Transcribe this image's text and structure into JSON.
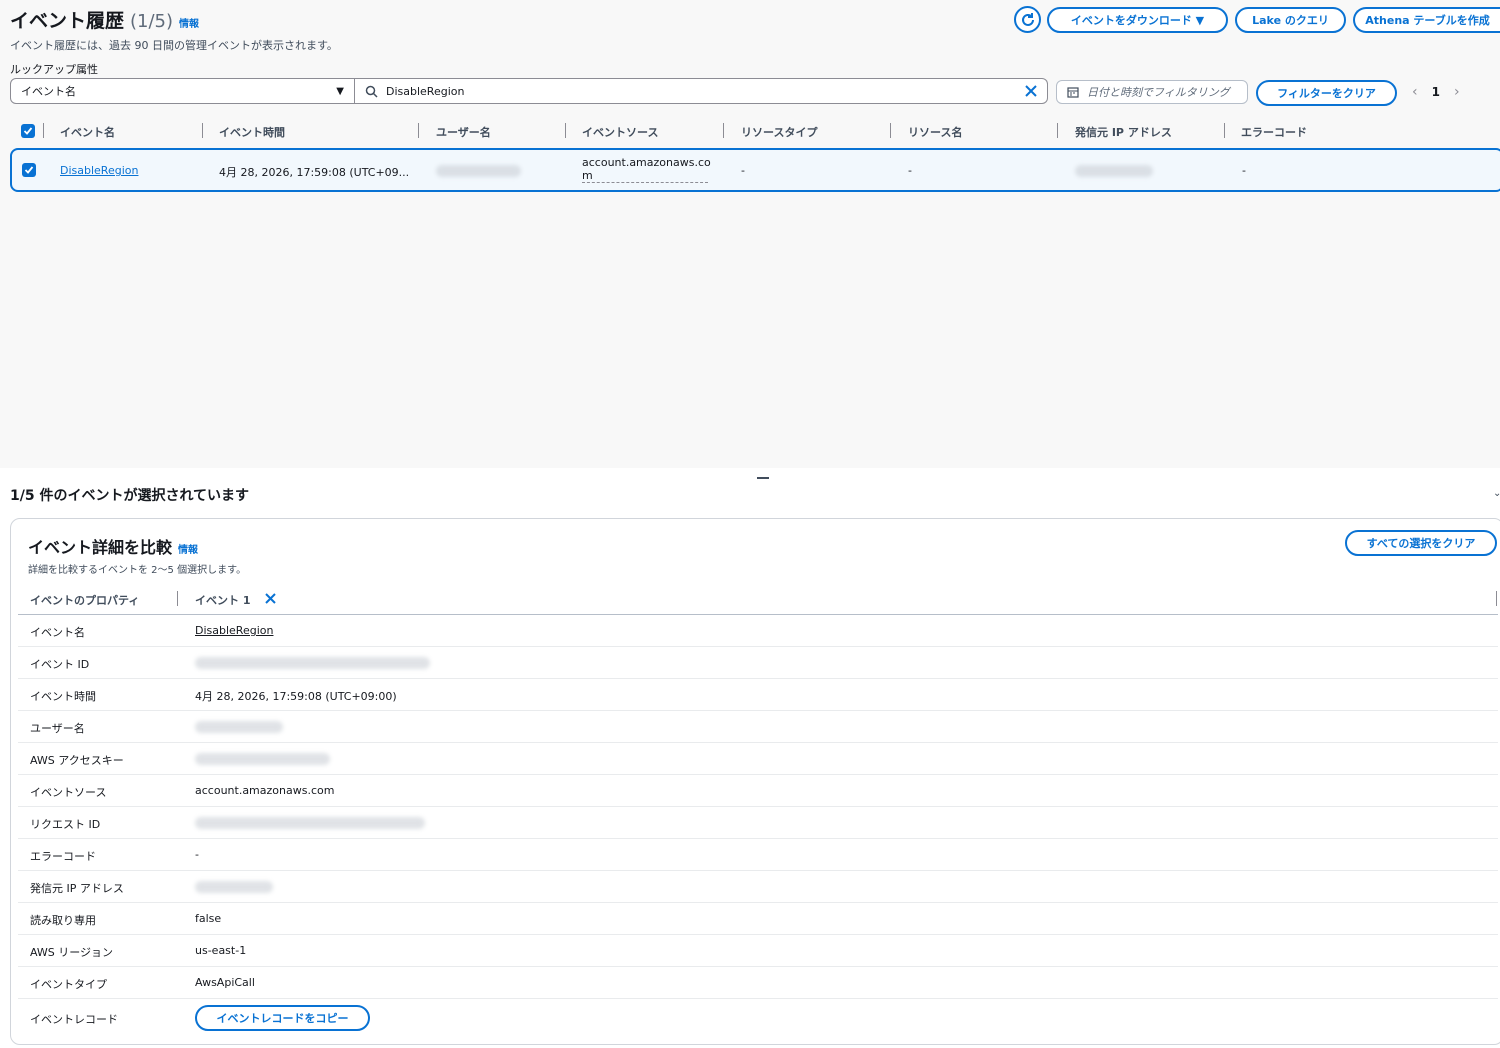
{
  "header": {
    "title": "イベント履歴",
    "count": "(1/5)",
    "info": "情報",
    "subtitle": "イベント履歴には、過去 90 日間の管理イベントが表示されます。",
    "lookup_label": "ルックアップ属性",
    "buttons": {
      "download": "イベントをダウンロード ▼",
      "lake_query": "Lake のクエリ",
      "athena": "Athena テーブルを作成"
    }
  },
  "filters": {
    "attribute": "イベント名",
    "search_value": "DisableRegion",
    "date_placeholder": "日付と時刻でフィルタリング",
    "clear_filters": "フィルターをクリア",
    "page": "1"
  },
  "table": {
    "columns": [
      "イベント名",
      "イベント時間",
      "ユーザー名",
      "イベントソース",
      "リソースタイプ",
      "リソース名",
      "発信元 IP アドレス",
      "エラーコード"
    ],
    "row": {
      "event_name": "DisableRegion",
      "event_time": "4月 28, 2026, 17:59:08 (UTC+09...",
      "event_source_line1": "account.amazonaws.co",
      "event_source_line2": "m",
      "resource_type": "-",
      "resource_name": "-",
      "error_code": "-"
    }
  },
  "selection": {
    "summary": "1/5 件のイベントが選択されています"
  },
  "compare": {
    "title": "イベント詳細を比較",
    "info": "情報",
    "subtitle": "詳細を比較するイベントを 2～5 個選択します。",
    "clear_all": "すべての選択をクリア",
    "col_property": "イベントのプロパティ",
    "col_event": "イベント 1",
    "rows": [
      {
        "key": "イベント名",
        "value": "DisableRegion"
      },
      {
        "key": "イベント ID",
        "value": ""
      },
      {
        "key": "イベント時間",
        "value": "4月 28, 2026, 17:59:08 (UTC+09:00)"
      },
      {
        "key": "ユーザー名",
        "value": ""
      },
      {
        "key": "AWS アクセスキー",
        "value": ""
      },
      {
        "key": "イベントソース",
        "value": "account.amazonaws.com"
      },
      {
        "key": "リクエスト ID",
        "value": ""
      },
      {
        "key": "エラーコード",
        "value": "-"
      },
      {
        "key": "発信元 IP アドレス",
        "value": ""
      },
      {
        "key": "読み取り専用",
        "value": "false"
      },
      {
        "key": "AWS リージョン",
        "value": "us-east-1"
      },
      {
        "key": "イベントタイプ",
        "value": "AwsApiCall"
      },
      {
        "key": "イベントレコード",
        "value": ""
      }
    ],
    "copy_record": "イベントレコードをコピー"
  }
}
